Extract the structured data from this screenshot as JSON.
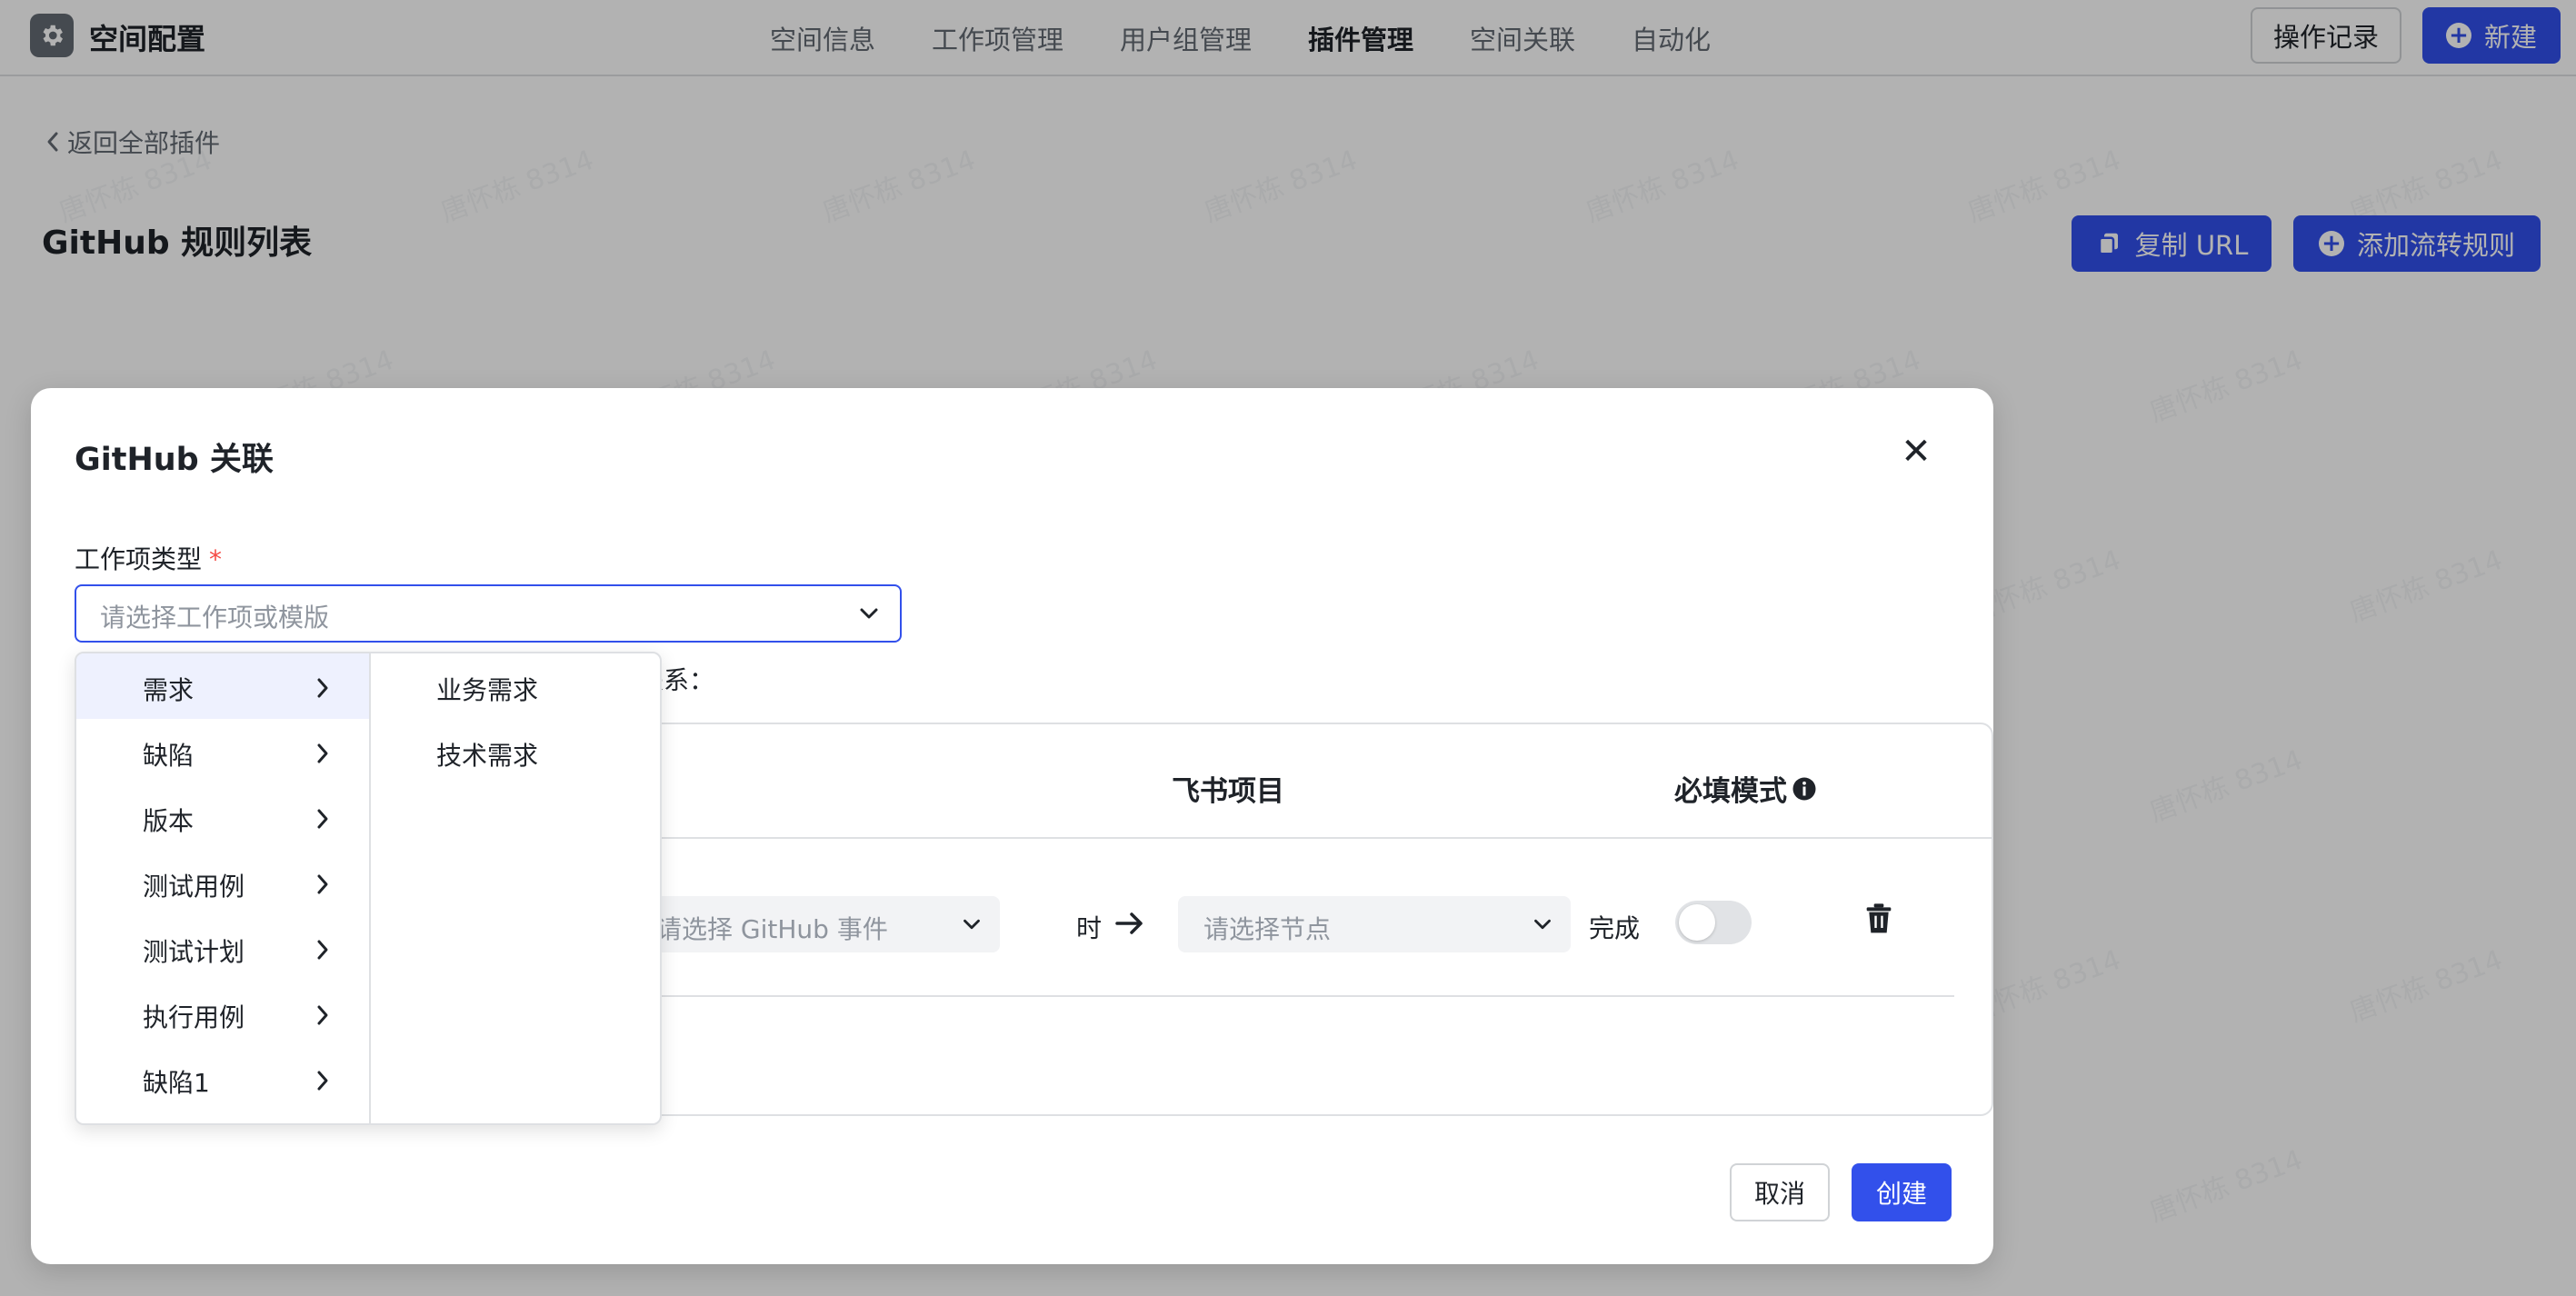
{
  "header": {
    "app_title": "空间配置",
    "tabs": [
      {
        "label": "空间信息"
      },
      {
        "label": "工作项管理"
      },
      {
        "label": "用户组管理"
      },
      {
        "label": "插件管理",
        "active": true
      },
      {
        "label": "空间关联"
      },
      {
        "label": "自动化"
      }
    ],
    "history_button": "操作记录",
    "new_button": "新建"
  },
  "page": {
    "back_link": "返回全部插件",
    "title": "GitHub 规则列表",
    "copy_url_button": "复制 URL",
    "add_rule_button": "添加流转规则"
  },
  "watermark": {
    "text": "唐怀栋 8314"
  },
  "modal": {
    "title": "GitHub 关联",
    "work_item_label": "工作项类型",
    "required_mark": "*",
    "work_item_placeholder": "请选择工作项或模版",
    "relation_partial": "寸关系：",
    "table_headers": {
      "feishu_project": "飞书项目",
      "required_mode": "必填模式"
    },
    "row": {
      "github_event_placeholder": "请选择 GitHub 事件",
      "when_text": "时",
      "node_placeholder": "请选择节点",
      "done_text": "完成",
      "required_toggle": false
    },
    "cancel_button": "取消",
    "create_button": "创建"
  },
  "dropdown": {
    "items": [
      {
        "label": "需求",
        "active": true
      },
      {
        "label": "缺陷"
      },
      {
        "label": "版本"
      },
      {
        "label": "测试用例"
      },
      {
        "label": "测试计划"
      },
      {
        "label": "执行用例"
      },
      {
        "label": "缺陷1"
      }
    ],
    "sub_items": [
      {
        "label": "业务需求"
      },
      {
        "label": "技术需求"
      }
    ]
  },
  "colors": {
    "primary": "#3250eb",
    "required": "#f54a45",
    "text": "#1f2329",
    "muted": "#646a73"
  },
  "icons": [
    "gear-icon",
    "plus-circle-icon",
    "chevron-left-icon",
    "copy-icon",
    "close-icon",
    "chevron-down-icon",
    "arrow-right-icon",
    "info-icon",
    "trash-icon",
    "chevron-right-icon"
  ]
}
